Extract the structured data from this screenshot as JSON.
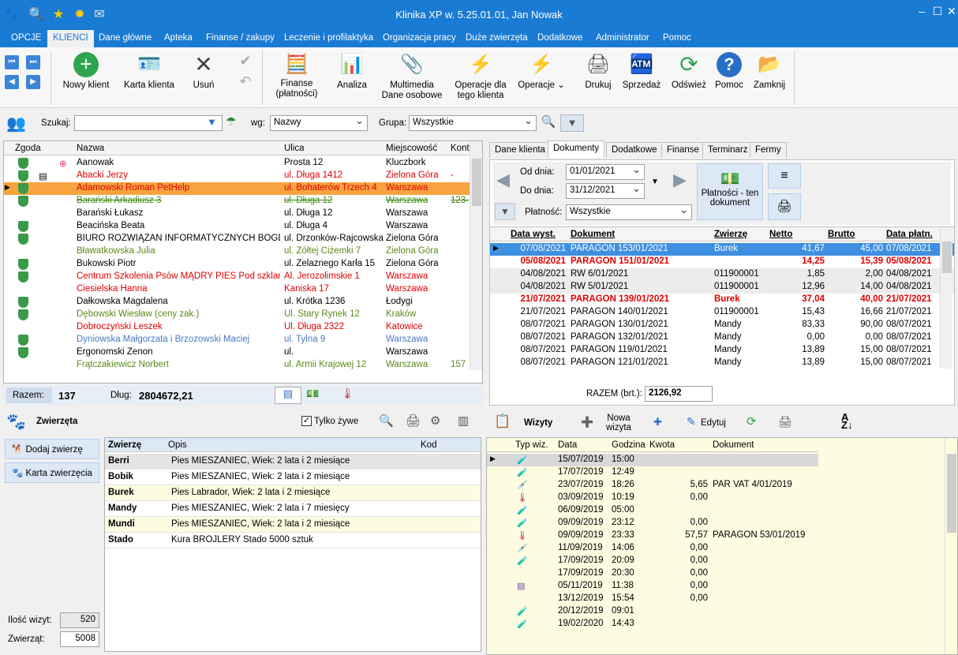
{
  "window": {
    "title": "Klinika XP w. 5.25.01.01, Jan Nowak"
  },
  "menu": [
    "OPCJE",
    "KLIENCI",
    "Dane główne",
    "Apteka",
    "Finanse / zakupy",
    "Leczenie i profilaktyka",
    "Organizacja pracy",
    "Duże zwierzęta",
    "Dodatkowe",
    "Administrator",
    "Pomoc"
  ],
  "ribbon": {
    "new_client": "Nowy klient",
    "client_card": "Karta klienta",
    "delete": "Usuń",
    "finance": "Finanse",
    "finance2": "(płatności)",
    "analysis": "Analiza",
    "multimedia": "Multimedia",
    "multimedia2": "Dane osobowe",
    "client_ops": "Operacje dla",
    "client_ops2": "tego klienta",
    "ops": "Operacje",
    "print": "Drukuj",
    "sale": "Sprzedaż",
    "refresh": "Odśwież",
    "help": "Pomoc",
    "close": "Zamknij"
  },
  "search": {
    "label": "Szukaj:",
    "value": "",
    "by_label": "wg:",
    "by_value": "Nazwy",
    "group_label": "Grupa:",
    "group_value": "Wszystkie"
  },
  "clients": {
    "headers": [
      "Zgoda",
      "Nazwa",
      "Ulica",
      "Miejscowość",
      "Kont"
    ],
    "rows": [
      {
        "name": "Aanowak",
        "street": "Prosta 12",
        "city": "Kluczbork",
        "kont": "",
        "cls": ""
      },
      {
        "name": "Abacki Jerzy",
        "street": "ul. Długa 1412",
        "city": "Zielona Góra",
        "kont": "-",
        "cls": "red"
      },
      {
        "name": "Adamowski Roman PetHelp",
        "street": "ul. Bohaterów Trzech 4",
        "city": "Warszawa",
        "kont": "",
        "cls": "red"
      },
      {
        "name": "Barański Arkadiusz 3",
        "street": "ul. Długa 12",
        "city": "Warszawa",
        "kont": "123-",
        "cls": "strike"
      },
      {
        "name": "Barański Łukasz",
        "street": "ul. Długa 12",
        "city": "Warszawa",
        "kont": "",
        "cls": ""
      },
      {
        "name": "Beacińska Beata",
        "street": "ul. Długa 4",
        "city": "Warszawa",
        "kont": "",
        "cls": ""
      },
      {
        "name": "BIURO ROZWIĄZAŃ INFORMATYCZNYCH BOGDAN A",
        "street": "ul. Drzonków-Rajcowska",
        "city": "Zielona Góra",
        "kont": "",
        "cls": ""
      },
      {
        "name": "Bławatkowska Julia",
        "street": "ul. Żółtej Ciżemki 7",
        "city": "Zielona Góra",
        "kont": "",
        "cls": "green"
      },
      {
        "name": "Bukowski Piotr",
        "street": "ul. Żelaznego Karła 15",
        "city": "Zielona Góra",
        "kont": "",
        "cls": ""
      },
      {
        "name": "Centrum Szkolenia Psów MĄDRY PIES Pod szklaną c",
        "street": "Al. Jerozolimskie 1",
        "city": "Warszawa",
        "kont": "",
        "cls": "red"
      },
      {
        "name": "Ciesielska Hanna",
        "street": "Kaniska 17",
        "city": "Warszawa",
        "kont": "",
        "cls": "red"
      },
      {
        "name": "Dałkowska Magdalena",
        "street": "ul. Krótka 1236",
        "city": "Łodygi",
        "kont": "",
        "cls": ""
      },
      {
        "name": "Dębowski Wiesław (ceny zak.)",
        "street": "Ul. Stary Rynek 12",
        "city": "Kraków",
        "kont": "",
        "cls": "green"
      },
      {
        "name": "Dobroczyński Leszek",
        "street": "Ul. Długa 2322",
        "city": "Katowice",
        "kont": "",
        "cls": "red"
      },
      {
        "name": "Dyniowska Małgorzata i Brzozowski Maciej",
        "street": "ul. Tylna 9",
        "city": "Warszawa",
        "kont": "",
        "cls": "blue"
      },
      {
        "name": "Ergonomski Zenon",
        "street": "ul.",
        "city": "Warszawa",
        "kont": "",
        "cls": ""
      },
      {
        "name": "Frątczakiewicz Norbert",
        "street": "ul. Armii Krajowej 12",
        "city": "Warszawa",
        "kont": "157",
        "cls": "green"
      }
    ],
    "razem_label": "Razem:",
    "razem": "137",
    "dlug_label": "Dług:",
    "dlug": "2804672,21"
  },
  "tabs": [
    "Dane klienta",
    "Dokumenty",
    "Dodatkowe",
    "Finanse",
    "Terminarz",
    "Fermy"
  ],
  "docs": {
    "od_label": "Od dnia:",
    "od": "01/01/2021",
    "do_label": "Do dnia:",
    "do": "31/12/2021",
    "platnosc_label": "Płatność:",
    "platnosc": "Wszystkie",
    "pay_btn": "Płatności - ten",
    "pay_btn2": "dokument",
    "headers": [
      "Data wyst.",
      "Dokument",
      "Zwierzę",
      "Netto",
      "Brutto",
      "Data płatn."
    ],
    "rows": [
      {
        "d": "07/08/2021",
        "doc": "PARAGON 153/01/2021",
        "z": "Burek",
        "n": "41,67",
        "b": "45,00",
        "p": "07/08/2021",
        "cls": "sel"
      },
      {
        "d": "05/08/2021",
        "doc": "PARAGON 151/01/2021",
        "z": "",
        "n": "14,25",
        "b": "15,39",
        "p": "05/08/2021",
        "cls": "boldred"
      },
      {
        "d": "04/08/2021",
        "doc": "RW 6/01/2021",
        "z": "011900001",
        "n": "1,85",
        "b": "2,00",
        "p": "04/08/2021",
        "cls": "gray"
      },
      {
        "d": "04/08/2021",
        "doc": "RW 5/01/2021",
        "z": "011900001",
        "n": "12,96",
        "b": "14,00",
        "p": "04/08/2021",
        "cls": "gray"
      },
      {
        "d": "21/07/2021",
        "doc": "PARAGON 139/01/2021",
        "z": "Burek",
        "n": "37,04",
        "b": "40,00",
        "p": "21/07/2021",
        "cls": "boldred"
      },
      {
        "d": "21/07/2021",
        "doc": "PARAGON 140/01/2021",
        "z": "011900001",
        "n": "15,43",
        "b": "16,66",
        "p": "21/07/2021",
        "cls": ""
      },
      {
        "d": "08/07/2021",
        "doc": "PARAGON 130/01/2021",
        "z": "Mandy",
        "n": "83,33",
        "b": "90,00",
        "p": "08/07/2021",
        "cls": ""
      },
      {
        "d": "08/07/2021",
        "doc": "PARAGON 132/01/2021",
        "z": "Mandy",
        "n": "0,00",
        "b": "0,00",
        "p": "08/07/2021",
        "cls": ""
      },
      {
        "d": "08/07/2021",
        "doc": "PARAGON 119/01/2021",
        "z": "Mandy",
        "n": "13,89",
        "b": "15,00",
        "p": "08/07/2021",
        "cls": ""
      },
      {
        "d": "08/07/2021",
        "doc": "PARAGON 121/01/2021",
        "z": "Mandy",
        "n": "13,89",
        "b": "15,00",
        "p": "08/07/2021",
        "cls": ""
      }
    ],
    "razem_label": "RAZEM (brt.):",
    "razem": "2126,92"
  },
  "animals": {
    "title": "Zwierzęta",
    "only_alive": "Tylko żywe",
    "add": "Dodaj zwierzę",
    "card": "Karta zwierzęcia",
    "headers": [
      "Zwierzę",
      "Opis",
      "Kod"
    ],
    "rows": [
      {
        "n": "Berri",
        "o": "Pies MIESZANIEC, Wiek: 2 lata i 2 miesiące",
        "cls": "selg"
      },
      {
        "n": "Bobik",
        "o": "Pies MIESZANIEC, Wiek: 2 lata i 2 miesiące",
        "cls": ""
      },
      {
        "n": "Burek",
        "o": "Pies Labrador, Wiek: 2 lata i 2 miesiące",
        "cls": "y"
      },
      {
        "n": "Mandy",
        "o": "Pies MIESZANIEC, Wiek: 2 lata i 7 miesięcy",
        "cls": ""
      },
      {
        "n": "Mundi",
        "o": "Pies MIESZANIEC, Wiek: 2 lata i 2 miesiące",
        "cls": "y"
      },
      {
        "n": "Stado",
        "o": "Kura BROJLERY Stado 5000 sztuk",
        "cls": ""
      }
    ],
    "visits_label": "Ilość wizyt:",
    "visits": "520",
    "animals_label": "Zwierząt:",
    "animals_count": "5008"
  },
  "visits": {
    "title": "Wizyty",
    "new": "Nowa",
    "new2": "wizyta",
    "edit": "Edytuj",
    "headers": [
      "Typ wiz.",
      "Data",
      "Godzina",
      "Kwota",
      "Dokument"
    ],
    "rows": [
      {
        "i": "tube",
        "d": "15/07/2019",
        "g": "15:00",
        "k": "",
        "doc": "",
        "cls": "selg"
      },
      {
        "i": "tube",
        "d": "17/07/2019",
        "g": "12:49",
        "k": "",
        "doc": "",
        "cls": ""
      },
      {
        "i": "syringe",
        "d": "23/07/2019",
        "g": "18:26",
        "k": "5,65",
        "doc": "PAR VAT 4/01/2019",
        "cls": ""
      },
      {
        "i": "therm",
        "d": "03/09/2019",
        "g": "10:19",
        "k": "0,00",
        "doc": "",
        "cls": ""
      },
      {
        "i": "tube",
        "d": "06/09/2019",
        "g": "05:00",
        "k": "",
        "doc": "",
        "cls": ""
      },
      {
        "i": "tube",
        "d": "09/09/2019",
        "g": "23:12",
        "k": "0,00",
        "doc": "",
        "cls": ""
      },
      {
        "i": "therm",
        "d": "09/09/2019",
        "g": "23:33",
        "k": "57,57",
        "doc": "PARAGON 53/01/2019",
        "cls": ""
      },
      {
        "i": "syringe",
        "d": "11/09/2019",
        "g": "14:06",
        "k": "0,00",
        "doc": "",
        "cls": ""
      },
      {
        "i": "tube",
        "d": "17/09/2019",
        "g": "20:09",
        "k": "0,00",
        "doc": "",
        "cls": ""
      },
      {
        "i": "",
        "d": "17/09/2019",
        "g": "20:30",
        "k": "0,00",
        "doc": "",
        "cls": ""
      },
      {
        "i": "card",
        "d": "05/11/2019",
        "g": "11:38",
        "k": "0,00",
        "doc": "",
        "cls": ""
      },
      {
        "i": "",
        "d": "13/12/2019",
        "g": "15:54",
        "k": "0,00",
        "doc": "",
        "cls": ""
      },
      {
        "i": "tube",
        "d": "20/12/2019",
        "g": "09:01",
        "k": "",
        "doc": "",
        "cls": ""
      },
      {
        "i": "tube",
        "d": "19/02/2020",
        "g": "14:43",
        "k": "",
        "doc": "",
        "cls": ""
      }
    ]
  }
}
